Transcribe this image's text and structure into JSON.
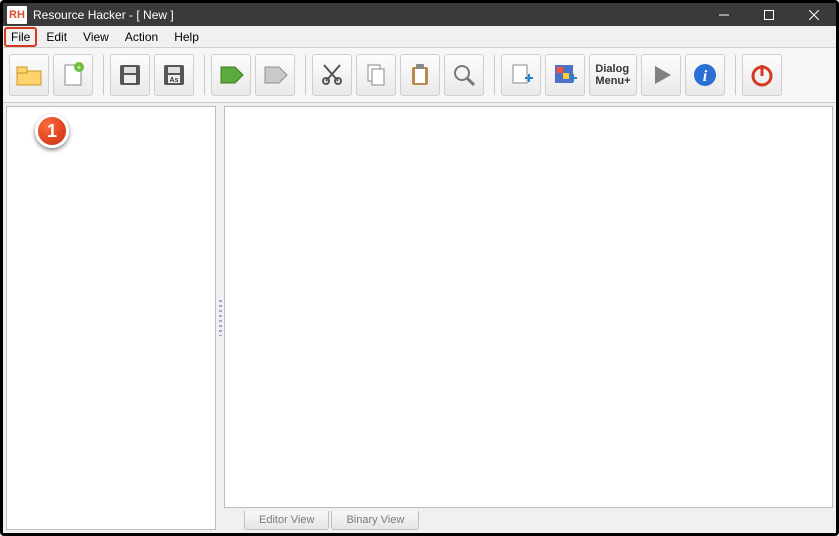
{
  "app_icon_text": "RH",
  "title": "Resource Hacker - [ New ]",
  "menu": {
    "file": "File",
    "edit": "Edit",
    "view": "View",
    "action": "Action",
    "help": "Help"
  },
  "toolbar": {
    "open": "open",
    "new": "new",
    "save": "save",
    "saveas": "save-as",
    "tag_green": "tag-green",
    "tag_grey": "tag-grey",
    "cut": "cut",
    "copy": "copy",
    "paste": "paste",
    "find": "find",
    "add_script": "add-script",
    "add_resource": "add-resource",
    "dialog_label": "Dialog\nMenu+",
    "play": "play",
    "info": "info",
    "exit": "exit"
  },
  "tabs": {
    "editor": "Editor View",
    "binary": "Binary View"
  },
  "annotation": {
    "step": "1"
  }
}
